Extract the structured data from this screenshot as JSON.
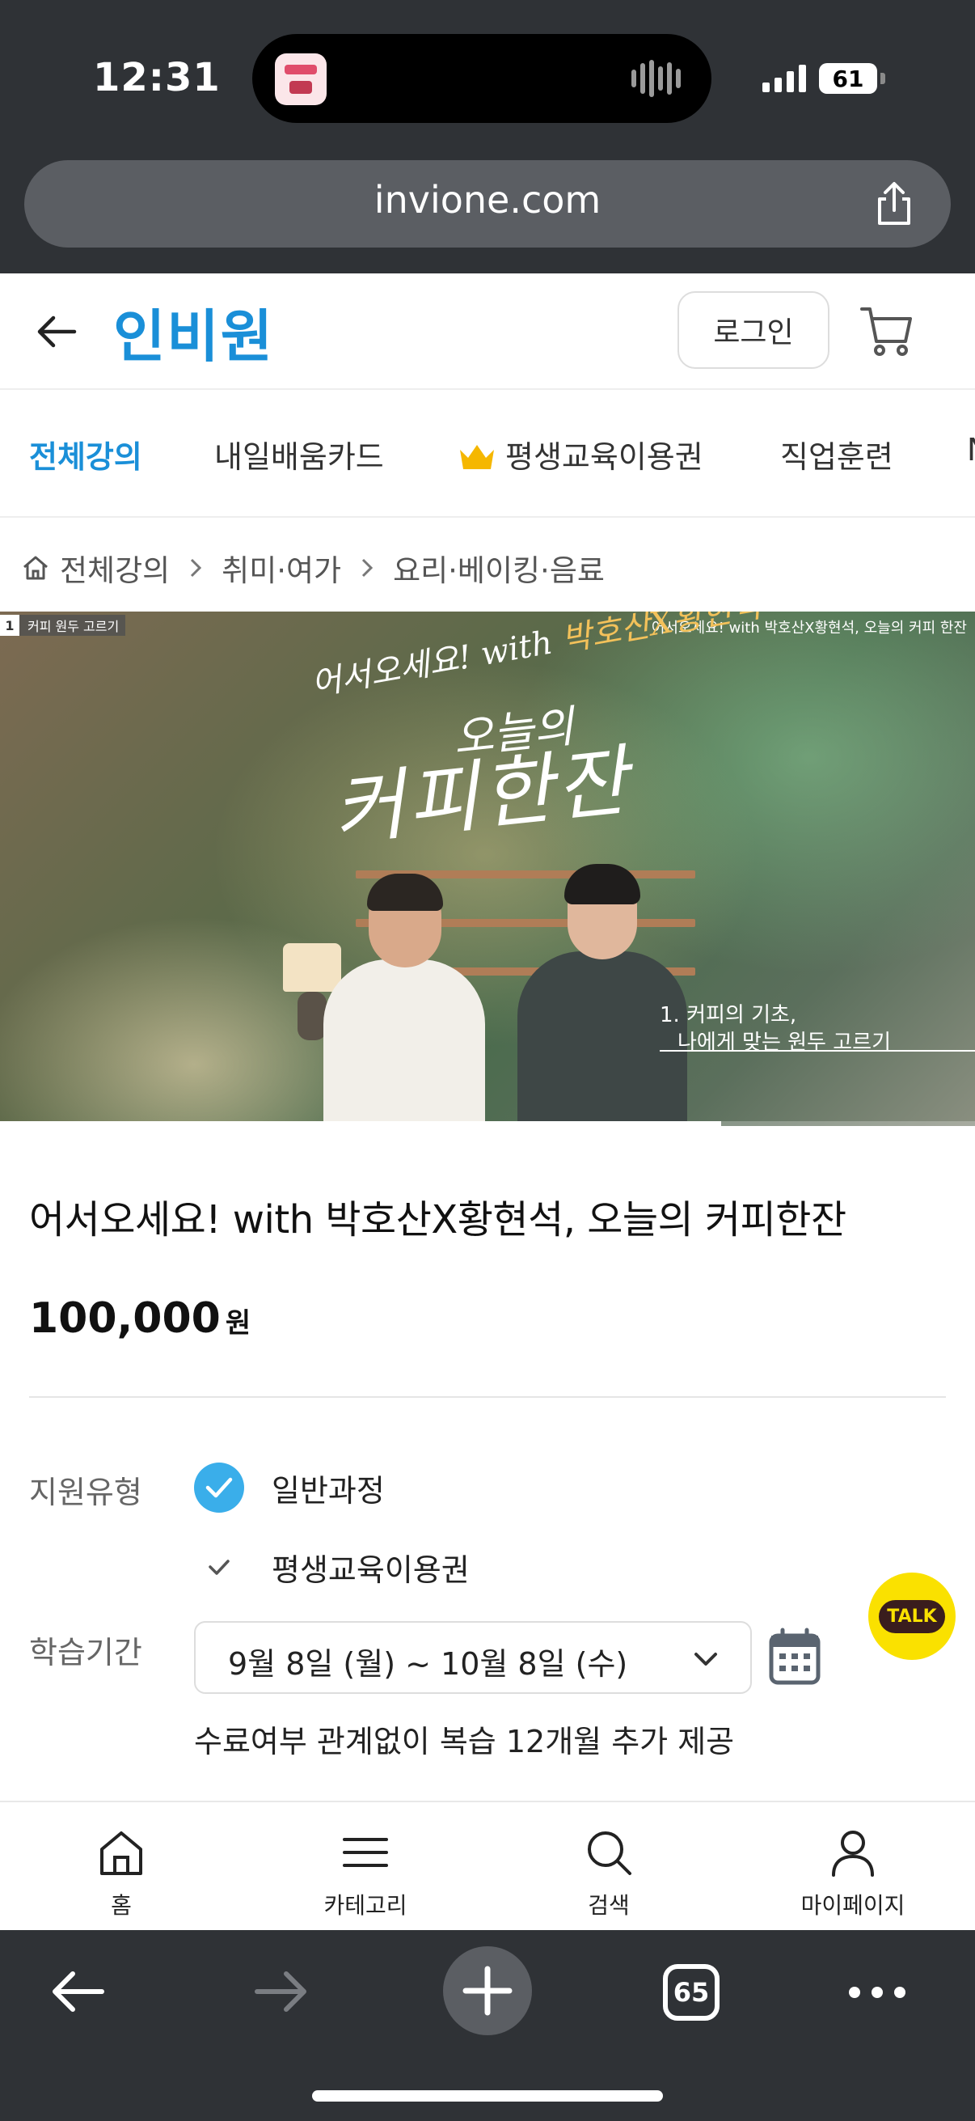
{
  "status_bar": {
    "time": "12:31",
    "battery": "61"
  },
  "browser": {
    "url": "invione.com",
    "tab_count": "65"
  },
  "header": {
    "logo": "인비원",
    "login_label": "로그인"
  },
  "category_tabs": [
    {
      "label": "전체강의"
    },
    {
      "label": "내일배움카드"
    },
    {
      "label": "평생교육이용권"
    },
    {
      "label": "직업훈련"
    }
  ],
  "breadcrumb": [
    "전체강의",
    "취미·여가",
    "요리·베이킹·음료"
  ],
  "video": {
    "chip_number": "1",
    "chip_text": "커피 원두 고르기",
    "top_caption": "어서오세요! with 박호산X황현석, 오늘의 커피 한잔",
    "script_line_prefix": "어서오세요! with ",
    "script_line_highlight": "박호산X황현석",
    "script_small": "오늘의",
    "script_big": "커피한잔",
    "subtitle_line1": "1. 커피의 기초,",
    "subtitle_line2": "나에게 맞는 원두 고르기",
    "progress_fraction": 0.74
  },
  "product": {
    "title": "어서오세요! with 박호산X황현석, 오늘의 커피한잔",
    "price": "100,000",
    "price_unit": "원",
    "support_label": "지원유형",
    "options": [
      {
        "label": "일반과정",
        "selected": true
      },
      {
        "label": "평생교육이용권",
        "selected": false
      }
    ],
    "period_label": "학습기간",
    "period_value": "9월 8일 (월) ~ 10월 8일 (수)",
    "note": "수료여부 관계없이 복습 12개월 추가 제공"
  },
  "kakao": {
    "label": "TALK"
  },
  "app_nav": [
    {
      "label": "홈",
      "icon": "home-icon"
    },
    {
      "label": "카테고리",
      "icon": "menu-icon"
    },
    {
      "label": "검색",
      "icon": "search-icon"
    },
    {
      "label": "마이페이지",
      "icon": "person-icon"
    }
  ],
  "colors": {
    "brand": "#1a8fd8",
    "check": "#3aaeea",
    "kakao": "#fae100",
    "chrome": "#2f3236"
  }
}
